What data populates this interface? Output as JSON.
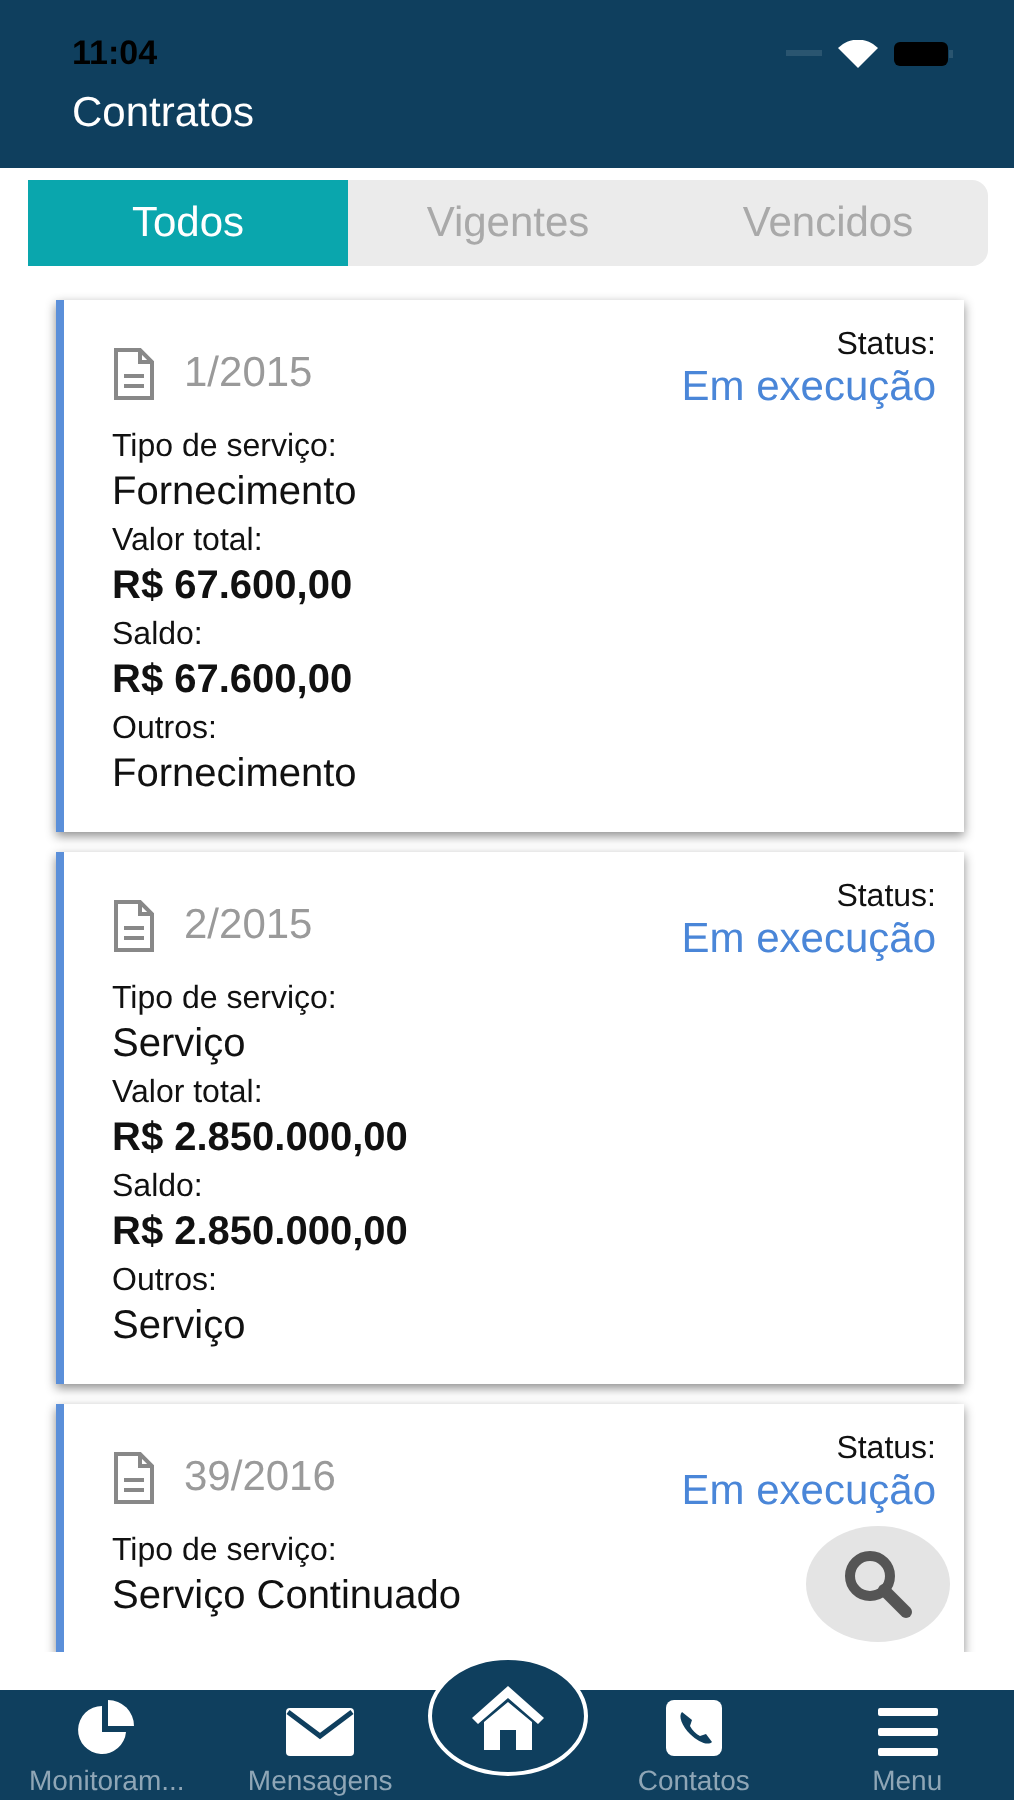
{
  "status_bar": {
    "time": "11:04"
  },
  "header": {
    "title": "Contratos"
  },
  "tabs": [
    {
      "label": "Todos",
      "selected": true
    },
    {
      "label": "Vigentes",
      "selected": false
    },
    {
      "label": "Vencidos",
      "selected": false
    }
  ],
  "contracts": [
    {
      "number": "1/2015",
      "status_label": "Status:",
      "status": "Em execução",
      "fields": [
        {
          "kind": "text",
          "label": "Tipo de serviço:",
          "value": "Fornecimento"
        },
        {
          "kind": "amount",
          "label": "Valor total:",
          "value": "R$ 67.600,00"
        },
        {
          "kind": "amount",
          "label": "Saldo:",
          "value": "R$ 67.600,00"
        },
        {
          "kind": "text",
          "label": "Outros:",
          "value": "Fornecimento"
        }
      ]
    },
    {
      "number": "2/2015",
      "status_label": "Status:",
      "status": "Em execução",
      "fields": [
        {
          "kind": "text",
          "label": "Tipo de serviço:",
          "value": "Serviço"
        },
        {
          "kind": "amount",
          "label": "Valor total:",
          "value": "R$ 2.850.000,00"
        },
        {
          "kind": "amount",
          "label": "Saldo:",
          "value": "R$ 2.850.000,00"
        },
        {
          "kind": "text",
          "label": "Outros:",
          "value": "Serviço"
        }
      ]
    },
    {
      "number": "39/2016",
      "status_label": "Status:",
      "status": "Em execução",
      "fields": [
        {
          "kind": "text",
          "label": "Tipo de serviço:",
          "value": "Serviço Continuado"
        }
      ]
    }
  ],
  "bottom_nav": [
    {
      "kind": "chart",
      "label": "Monitoram..."
    },
    {
      "kind": "mail",
      "label": "Mensagens"
    },
    {
      "kind": "home"
    },
    {
      "kind": "phone",
      "label": "Contatos"
    },
    {
      "kind": "menu",
      "label": "Menu"
    }
  ]
}
